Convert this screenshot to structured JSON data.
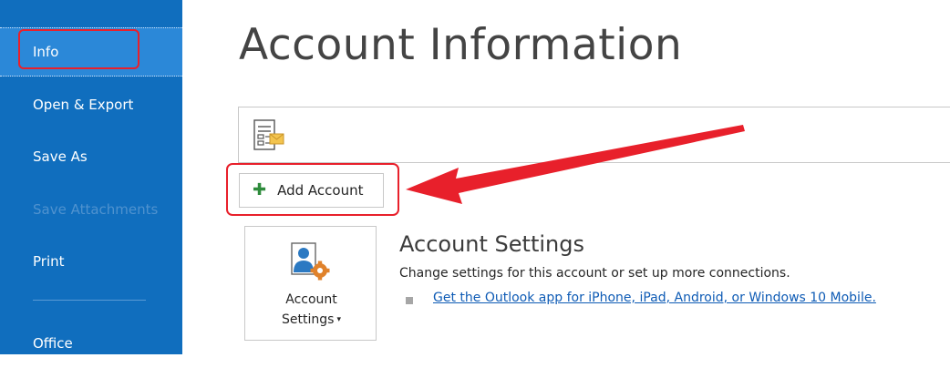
{
  "sidebar": {
    "items": [
      {
        "label": "Info",
        "state": "active"
      },
      {
        "label": "Open & Export",
        "state": "normal"
      },
      {
        "label": "Save As",
        "state": "normal"
      },
      {
        "label": "Save Attachments",
        "state": "disabled"
      },
      {
        "label": "Print",
        "state": "normal"
      },
      {
        "label": "Office",
        "state": "normal"
      }
    ]
  },
  "main": {
    "title": "Account Information",
    "add_account_label": "Add Account",
    "account_settings": {
      "button_line1": "Account",
      "button_line2": "Settings",
      "heading": "Account Settings",
      "description": "Change settings for this account or set up more connections.",
      "link": "Get the Outlook app for iPhone, iPad, Android, or Windows 10 Mobile."
    }
  },
  "icons": {
    "add": "plus-icon",
    "account_selector": "account-selector-icon",
    "account_settings": "account-settings-icon"
  },
  "colors": {
    "sidebar_bg": "#106ebe",
    "sidebar_active": "#2b88d8",
    "annotation_red": "#e8202b",
    "link": "#0e5bb5"
  }
}
